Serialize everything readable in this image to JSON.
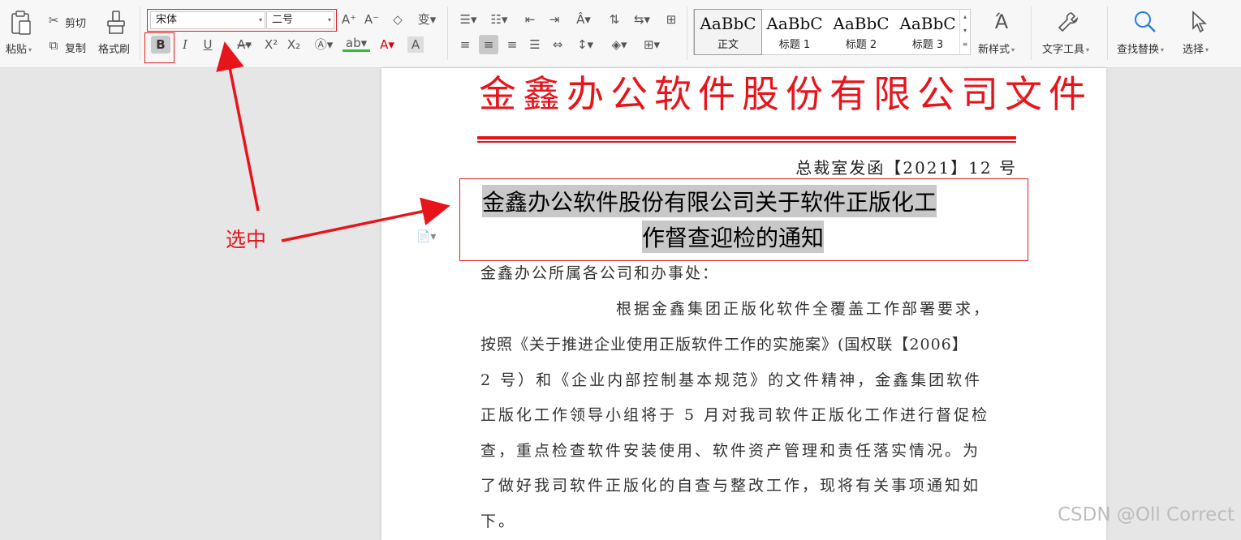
{
  "ribbon": {
    "clipboard": {
      "paste": "粘贴",
      "cut": "剪切",
      "copy": "复制",
      "format_painter": "格式刷"
    },
    "font": {
      "family": "宋体",
      "size": "二号",
      "bold": "B",
      "italic": "I",
      "underline": "U"
    },
    "styles": [
      {
        "sample": "AaBbC",
        "name": "正文"
      },
      {
        "sample": "AaBbC",
        "name": "标题 1"
      },
      {
        "sample": "AaBbC",
        "name": "标题 2"
      },
      {
        "sample": "AaBbC",
        "name": "标题 3"
      }
    ],
    "new_style": "新样式",
    "text_tools": "文字工具",
    "find_replace": "查找替换",
    "select": "选择"
  },
  "document": {
    "header": "金鑫办公软件股份有限公司文件",
    "doc_number": "总裁室发函【2021】12 号",
    "title_line1": "金鑫办公软件股份有限公司关于软件正版化工",
    "title_line2": "作督查迎检的通知",
    "addressee": "金鑫办公所属各公司和办事处：",
    "body_lines": [
      "根据金鑫集团正版化软件全覆盖工作部署要求，",
      "按照《关于推进企业使用正版软件工作的实施案》(国权联【2006】",
      "2 号）和《企业内部控制基本规范》的文件精神，金鑫集团软件",
      "正版化工作领导小组将于 5 月对我司软件正版化工作进行督促检",
      "查，重点检查软件安装使用、软件资产管理和责任落实情况。为",
      "了做好我司软件正版化的自查与整改工作，现将有关事项通知如",
      "下。"
    ]
  },
  "annotation": {
    "label": "选中"
  },
  "watermark": "CSDN @Oll Correct",
  "colors": {
    "accent_red": "#e8141c",
    "selection": "#c8c8c8"
  }
}
